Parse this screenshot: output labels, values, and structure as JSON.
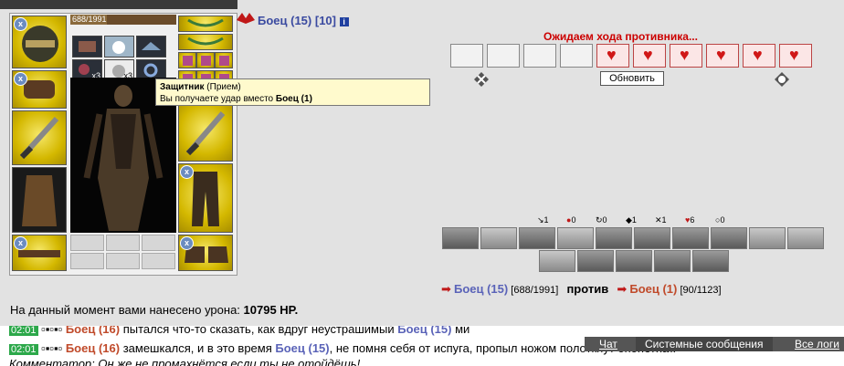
{
  "header": {
    "player_name": "Боец (15)",
    "player_bracket": "[10]",
    "info_icon": "i",
    "waiting_text": "Ожидаем хода противника...",
    "refresh_label": "Обновить"
  },
  "character": {
    "hp_text": "688/1991",
    "hp_fraction": 0.346,
    "stack_a": "x3",
    "stack_b": "x3",
    "emblem": "x"
  },
  "tooltip": {
    "title": "Защитник",
    "type": "(Прием)",
    "line_prefix": "Вы получаете удар вместо ",
    "line_target": "Боец (1)"
  },
  "stats": [
    {
      "icon": "sword-icon",
      "value": "1"
    },
    {
      "icon": "blood-drop-icon",
      "value": "0"
    },
    {
      "icon": "swirl-icon",
      "value": "0"
    },
    {
      "icon": "shield-icon",
      "value": "1"
    },
    {
      "icon": "crossed-swords-icon",
      "value": "1"
    },
    {
      "icon": "heart-icon",
      "value": "6"
    },
    {
      "icon": "spirit-icon",
      "value": "0"
    }
  ],
  "versus": {
    "left_name": "Боец (15)",
    "left_hp": "[688/1991]",
    "vs_word": "против",
    "right_name": "Боец (1)",
    "right_hp": "[90/1123]"
  },
  "damage": {
    "prefix": "На данный момент вами нанесено урона: ",
    "value": "10795 HP."
  },
  "log": {
    "line1_time": "02:01",
    "line1_name1": "Боец (16)",
    "line1_text1": " пытался что-то сказать, как вдруг неустрашимый ",
    "line1_name2": "Боец (15)",
    "line1_text2": " ми",
    "line2_time": "02:01",
    "line2_name1": "Боец (16)",
    "line2_text1": " замешкался, и в это время ",
    "line2_name2": "Боец (15)",
    "line2_text2": ", не помня себя от испуга, пропыл ножом полоткнут опонетнат.",
    "line3": "Комментатор: Он же не промахнётся если ты не отойдёшь!"
  },
  "chat_tabs": {
    "chat": "Чат",
    "system": "Системные сообщения",
    "all": "Все логи"
  },
  "colors": {
    "waiting_red": "#cc0000",
    "name_blue": "#5a63b8",
    "name_red": "#c04a2a",
    "tooltip_bg": "#fffacd"
  }
}
